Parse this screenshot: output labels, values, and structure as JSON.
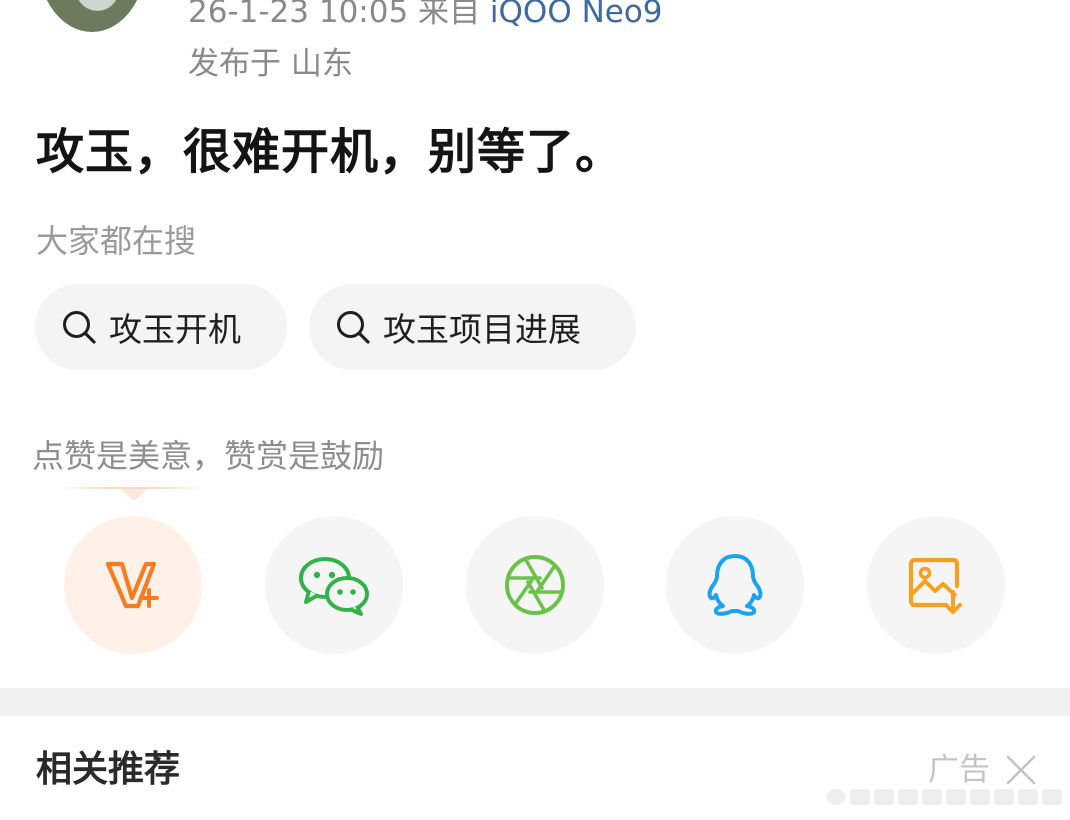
{
  "header": {
    "timestamp": "26-1-23 10:05",
    "source_prefix": "来自",
    "device": "iQOO Neo9",
    "location": "发布于 山东"
  },
  "post": {
    "text": "攻玉，很难开机，别等了。"
  },
  "search": {
    "title": "大家都在搜",
    "chips": [
      "攻玉开机",
      "攻玉项目进展"
    ]
  },
  "reward": {
    "text": "点赞是美意，赞赏是鼓励"
  },
  "share": {
    "buttons": [
      {
        "icon": "v-plus-icon",
        "color": "#f57c1f"
      },
      {
        "icon": "wechat-icon",
        "color": "#34b24a"
      },
      {
        "icon": "moments-icon",
        "color": "#6cc14a"
      },
      {
        "icon": "qq-icon",
        "color": "#1aa3f0"
      },
      {
        "icon": "save-image-icon",
        "color": "#f5a01f"
      }
    ]
  },
  "related": {
    "title": "相关推荐",
    "ad_label": "广告"
  },
  "colors": {
    "meta_gray": "#8a8a8a",
    "device_blue": "#3f6a9e",
    "chip_bg": "#f4f4f4",
    "accent_orange": "#f57c1f"
  }
}
